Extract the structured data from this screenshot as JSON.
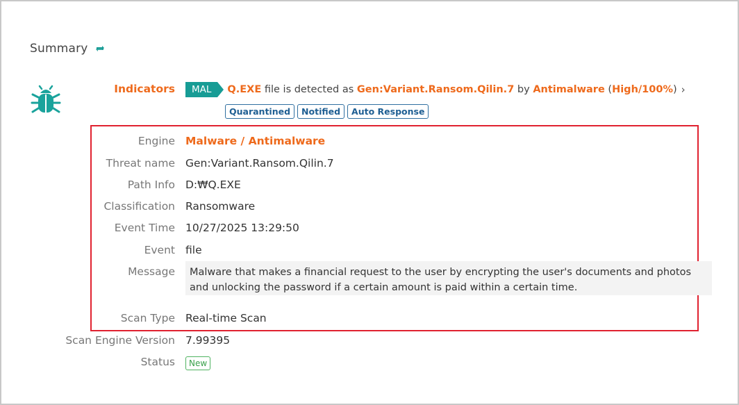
{
  "summary": {
    "title": "Summary",
    "refresh_icon": "refresh-icon"
  },
  "indicators": {
    "label": "Indicators",
    "icon": "bug-icon",
    "tag": "MAL",
    "file_name": "Q.EXE",
    "text_detected": "file is detected as",
    "detection_name": "Gen:Variant.Ransom.Qilin.7",
    "text_by": "by",
    "engine_name": "Antimalware",
    "open_paren": "(",
    "severity": "High/100%",
    "close_paren": ")",
    "chevron": "›",
    "badges": [
      "Quarantined",
      "Notified",
      "Auto Response"
    ]
  },
  "details": {
    "engine": {
      "label": "Engine",
      "value": "Malware / Antimalware"
    },
    "threat_name": {
      "label": "Threat name",
      "value": "Gen:Variant.Ransom.Qilin.7"
    },
    "path_info": {
      "label": "Path Info",
      "value": "D:₩Q.EXE"
    },
    "classification": {
      "label": "Classification",
      "value": "Ransomware"
    },
    "event_time": {
      "label": "Event Time",
      "value": "10/27/2025 13:29:50"
    },
    "event": {
      "label": "Event",
      "value": "file"
    },
    "message": {
      "label": "Message",
      "value": "Malware that makes a financial request to the user by encrypting the user's documents and photos and unlocking the password if a certain amount is paid within a certain time."
    },
    "scan_type": {
      "label": "Scan Type",
      "value": "Real-time Scan"
    },
    "scan_engine_version": {
      "label": "Scan Engine Version",
      "value": "7.99395"
    },
    "status": {
      "label": "Status",
      "value": "New"
    }
  },
  "colors": {
    "accent_orange": "#ee6a1c",
    "teal": "#179c95",
    "highlight_red": "#e0212f",
    "badge_blue": "#1f5f93",
    "status_green": "#3aa14b"
  }
}
